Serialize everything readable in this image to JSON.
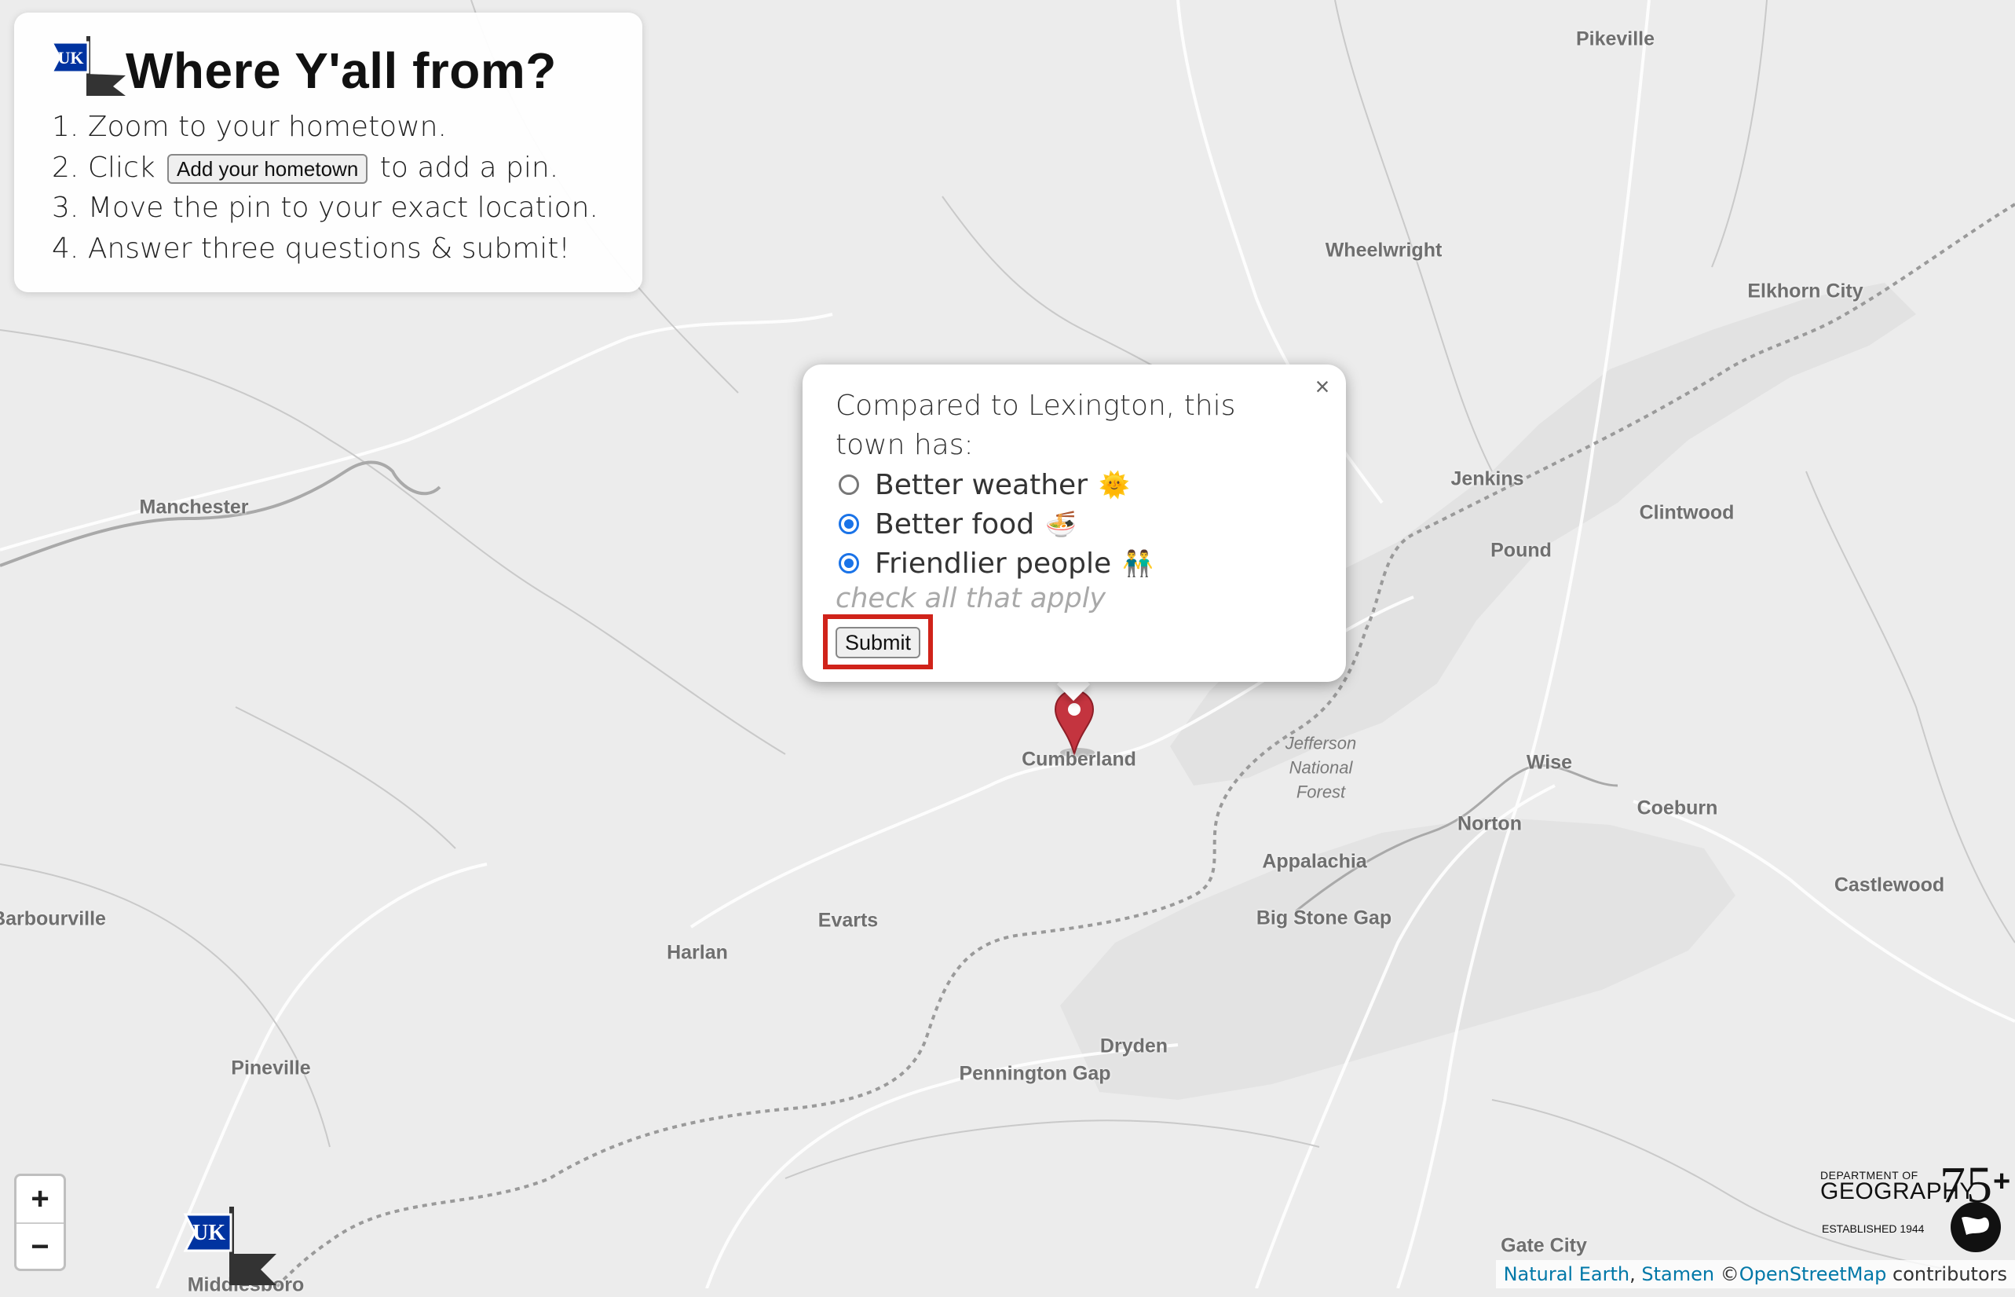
{
  "panel": {
    "title": "Where Y'all from?",
    "steps": [
      {
        "num": "1.",
        "text": "Zoom to your hometown."
      },
      {
        "num": "2.",
        "pre": "Click",
        "button": "Add your hometown",
        "post": "to add a pin."
      },
      {
        "num": "3.",
        "text": "Move the pin to your exact location."
      },
      {
        "num": "4.",
        "text": "Answer three questions & submit!"
      }
    ]
  },
  "popup": {
    "close": "×",
    "question": "Compared to Lexington, this town has:",
    "options": [
      {
        "label": "Better weather",
        "emoji": "🌞",
        "checked": false
      },
      {
        "label": "Better food",
        "emoji": "🍜",
        "checked": true
      },
      {
        "label": "Friendlier people",
        "emoji": "👬",
        "checked": true
      }
    ],
    "hint": "check all that apply",
    "submit": "Submit"
  },
  "map": {
    "towns": [
      "Pikeville",
      "Wheelwright",
      "Elkhorn City",
      "Manchester",
      "Jenkins",
      "Clintwood",
      "Pound",
      "Cumberland",
      "Wise",
      "Norton",
      "Coeburn",
      "Appalachia",
      "Big Stone Gap",
      "Castlewood",
      "Barbourville",
      "Evarts",
      "Harlan",
      "Dryden",
      "Pennington Gap",
      "Pineville",
      "Gate City",
      "Middlesboro"
    ],
    "forest": [
      "Jefferson",
      "National",
      "Forest"
    ],
    "colors": {
      "background": "#ececec",
      "roads": "#ffffff",
      "state_border": "#9a9a9a",
      "river": "#aaaaaa",
      "marker": "#c4343f",
      "forest": "#e2e2e2"
    }
  },
  "zoom": {
    "in": "+",
    "out": "−"
  },
  "attribution": {
    "natural_earth": "Natural Earth",
    "sep": ",",
    "stamen": "Stamen",
    "copy": "©",
    "osm": "OpenStreetMap",
    "tail": "contributors"
  },
  "logo": {
    "dept": "DEPARTMENT OF",
    "geo": "GEOGRAPHY",
    "est": "ESTABLISHED 1944",
    "num": "75+"
  }
}
